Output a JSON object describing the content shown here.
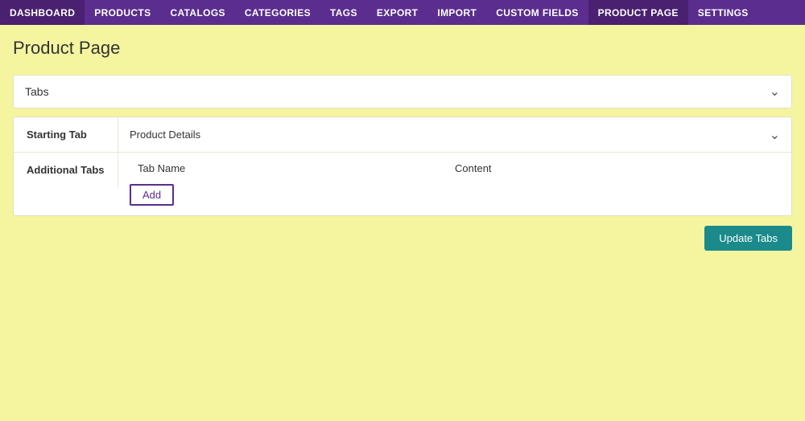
{
  "nav": {
    "items": [
      {
        "id": "dashboard",
        "label": "DASHBOARD"
      },
      {
        "id": "products",
        "label": "PRODUCTS"
      },
      {
        "id": "catalogs",
        "label": "CATALOGS"
      },
      {
        "id": "categories",
        "label": "CATEGORIES"
      },
      {
        "id": "tags",
        "label": "TAGS"
      },
      {
        "id": "export",
        "label": "EXPORT"
      },
      {
        "id": "import",
        "label": "IMPORT"
      },
      {
        "id": "custom-fields",
        "label": "CUSTOM FIELDS"
      },
      {
        "id": "product-page",
        "label": "PRODUCT PAGE"
      },
      {
        "id": "settings",
        "label": "SETTINGS"
      }
    ]
  },
  "page": {
    "title": "Product Page"
  },
  "tabs_section": {
    "header_label": "Tabs",
    "starting_tab": {
      "label": "Starting Tab",
      "value": "Product Details"
    },
    "additional_tabs": {
      "label": "Additional Tabs",
      "col_tab_name": "Tab Name",
      "col_content": "Content",
      "add_button_label": "Add"
    },
    "update_button_label": "Update Tabs"
  }
}
